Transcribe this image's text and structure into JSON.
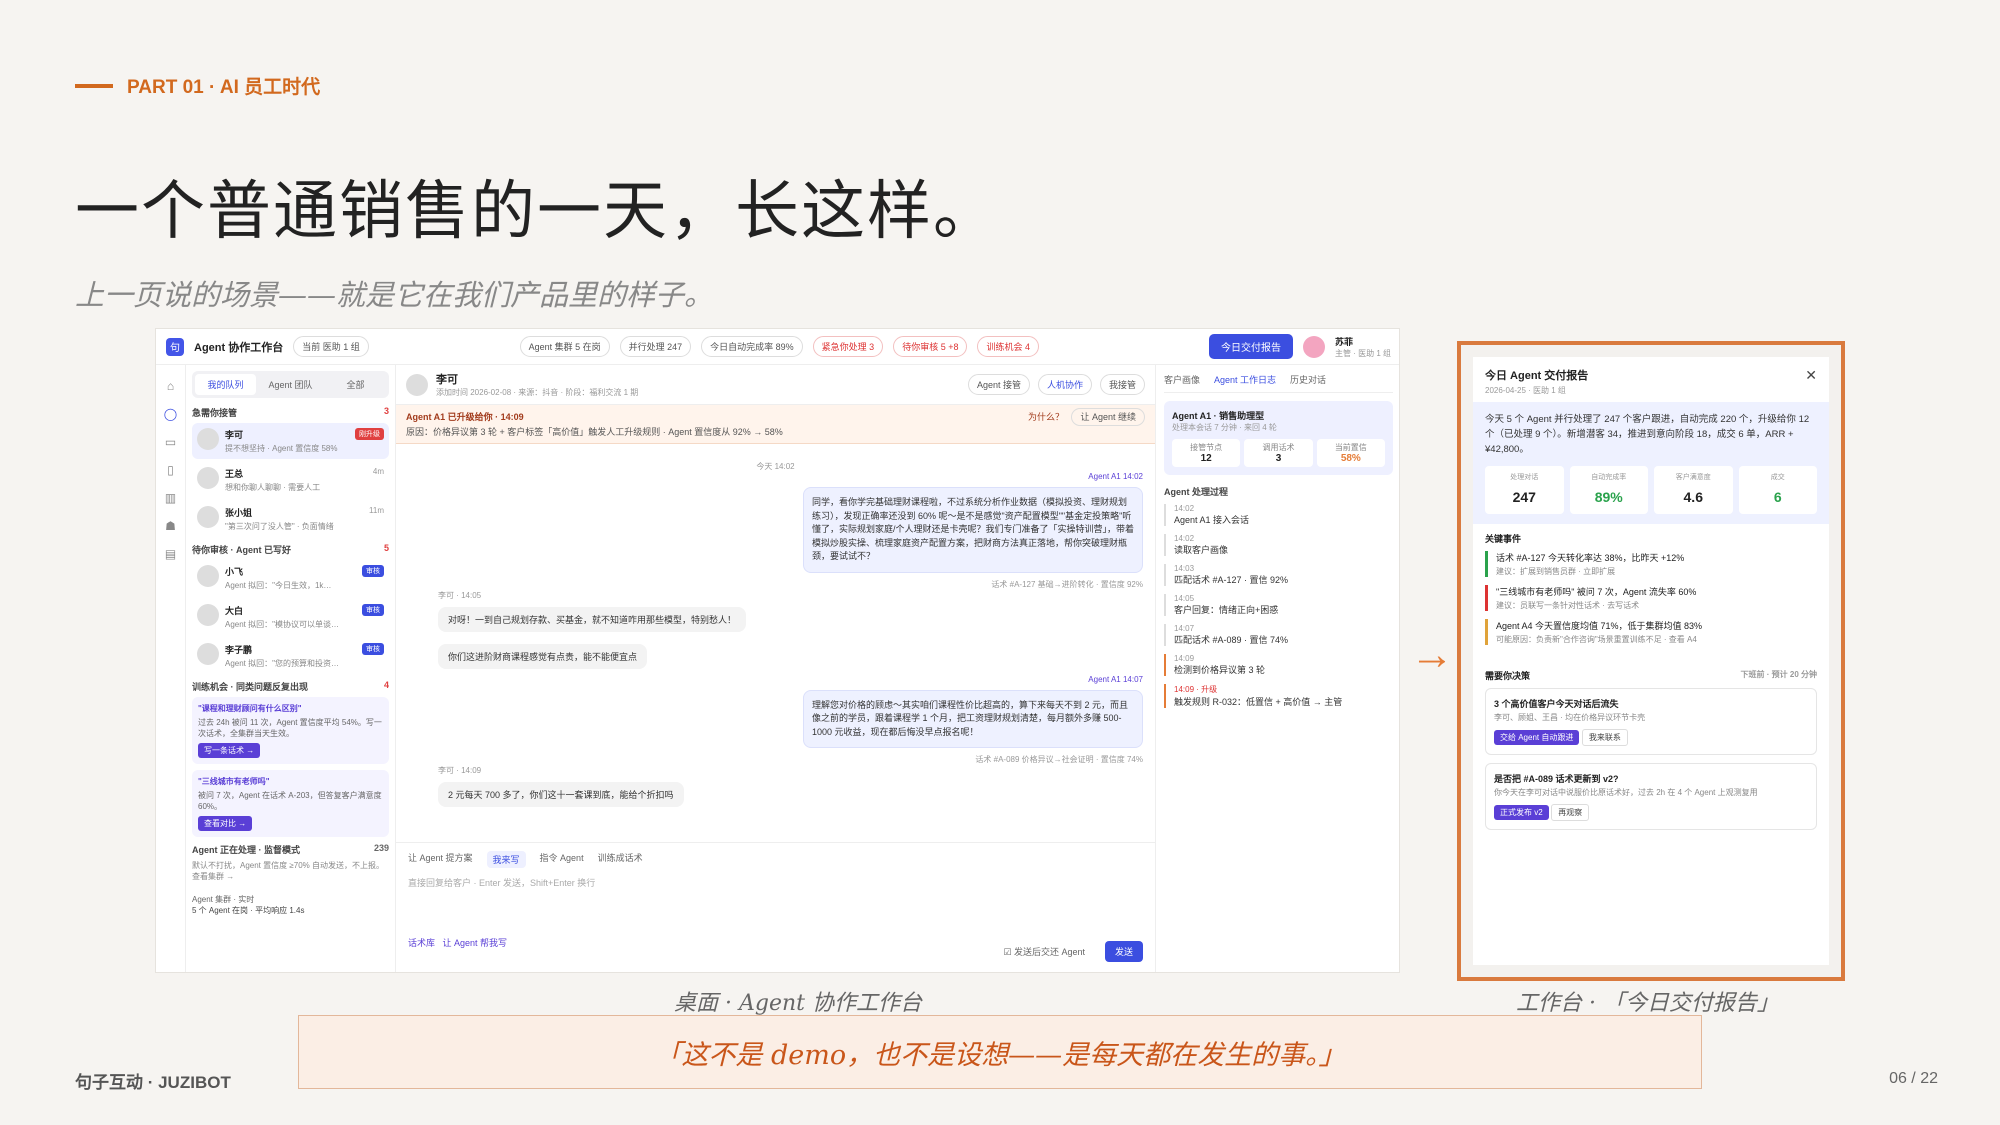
{
  "part": "PART 01 · AI 员工时代",
  "title": "一个普通销售的一天，长这样。",
  "subtitle": "上一页说的场景——就是它在我们产品里的样子。",
  "app": {
    "name": "Agent 协作工作台",
    "current_team": "当前  医助 1 组",
    "status_pills": [
      "Agent 集群  5 在岗",
      "并行处理 247",
      "今日自动完成率 89%"
    ],
    "alerts": [
      "紧急你处理 3",
      "待你审核 5 +8",
      "训练机会 4"
    ],
    "report_btn": "今日交付报告",
    "user_name": "苏菲",
    "user_role": "主管 · 医助 1 组",
    "queue_tabs": [
      "我的队列",
      "Agent 团队",
      "全部"
    ],
    "sec_urgent": "急需你接管",
    "sec_urgent_n": "3",
    "urgent_items": [
      {
        "name": "李可",
        "desc": "提不想坚持 · Agent 置信度 58%",
        "tag": "刚升级"
      },
      {
        "name": "王总",
        "desc": "想和你聊人聊聊 · 需要人工",
        "tag": "4m"
      },
      {
        "name": "张小姐",
        "desc": "\"第三次问了没人管\" · 负面情绪",
        "tag": "11m"
      }
    ],
    "sec_review": "待你审核 · Agent 已写好",
    "sec_review_n": "5",
    "review_items": [
      {
        "name": "小飞",
        "desc": "Agent 拟回：\"今日生效，1k…",
        "tag": "审核"
      },
      {
        "name": "大白",
        "desc": "Agent 拟回：\"模协议可以单谈…",
        "tag": "审核"
      },
      {
        "name": "李子鹏",
        "desc": "Agent 拟回：\"您的预算和投资…",
        "tag": "审核"
      }
    ],
    "sec_train": "训练机会 · 同类问题反复出现",
    "sec_train_n": "4",
    "train_cards": [
      {
        "title": "\"课程和理财顾问有什么区别\"",
        "desc": "过去 24h 被问 11 次，Agent 置信度平均 54%。写一次话术，全集群当天生效。",
        "btn": "写一条话术 →"
      },
      {
        "title": "\"三线城市有老师吗\"",
        "desc": "被问 7 次，Agent 在话术 A-203，但答复客户满意度 60%。",
        "btn": "查看对比 →"
      }
    ],
    "sec_watch": "Agent 正在处理 · 监督模式",
    "sec_watch_n": "239",
    "watch_desc": "默认不打扰，Agent 置信度 ≥70% 自动发送，不上报。查看集群 →",
    "fleet": "Agent 集群 · 实时",
    "fleet_desc": "5 个 Agent 在岗 · 平均响应 1.4s",
    "chat_name": "李可",
    "chat_meta": "添加时间 2026-02-08 · 来源：抖音 · 阶段：福利交流 1 期",
    "chat_actions": [
      "Agent 接管",
      "人机协作",
      "我接管"
    ],
    "alert_title": "Agent A1 已升级给你 · 14:09",
    "alert_desc": "原因：价格异议第 3 轮 + 客户标签「高价值」触发人工升级规则 · Agent 置信度从 92% → 58%",
    "alert_why": "为什么？",
    "alert_takeover": "让 Agent 继续",
    "time_today": "今天 14:02",
    "msg1_from": "Agent A1  14:02",
    "msg1": "同学，看你学完基础理财课程啦，不过系统分析作业数据（模拟投资、理财规划练习），发现正确率还没到 60% 呢～是不是感觉\"资产配置模型\"\"基金定投策略\"听懂了，实际规划家庭/个人理财还是卡壳呢？我们专门准备了「实操特训营」，带着模拟炒股实操、梳理家庭资产配置方案，把财商方法真正落地，帮你突破理财瓶颈，要试试不？",
    "msg1_meta": "话术 #A-127 基础→进阶转化 · 置信度 92%",
    "msg2_from": "李可 · 14:05",
    "msg2": "对呀！一到自己规划存款、买基金，就不知道咋用那些模型，特别愁人！",
    "msg3": "你们这进阶财商课程感觉有点贵，能不能便宜点",
    "msg4_from": "Agent A1  14:07",
    "msg4": "理解您对价格的顾虑～其实咱们课程性价比超高的，算下来每天不到 2 元，而且像之前的学员，跟着课程学 1 个月，把工资理财规划清楚，每月额外多赚 500-1000 元收益，现在都后悔没早点报名呢！",
    "msg4_meta": "话术 #A-089 价格异议→社会证明 · 置信度 74%",
    "msg5_from": "李可 · 14:09",
    "msg5": "2 元每天 700 多了，你们这十一套课到底，能给个折扣吗",
    "composer_tabs": [
      "让 Agent 提方案",
      "我来写",
      "指令 Agent",
      "训练成话术"
    ],
    "composer_hint": "直接回复给客户 · Enter 发送，Shift+Enter 换行",
    "composer_extra": [
      "话术库",
      "让 Agent 帮我写"
    ],
    "composer_check": "发送后交还 Agent",
    "send": "发送",
    "side_tabs": [
      "客户画像",
      "Agent 工作日志",
      "历史对话"
    ],
    "agent_name": "Agent A1 · 销售助理型",
    "agent_sub": "处理本会话 7 分钟 · 来回 4 轮",
    "agent_kpis": [
      {
        "k": "接管节点",
        "v": "12"
      },
      {
        "k": "调用话术",
        "v": "3"
      },
      {
        "k": "当前置信",
        "v": "58%"
      }
    ],
    "timeline_title": "Agent 处理过程",
    "timeline": [
      {
        "t": "14:02",
        "x": "Agent A1 接入会话"
      },
      {
        "t": "14:02",
        "x": "读取客户画像"
      },
      {
        "t": "14:03",
        "x": "匹配话术 #A-127 · 置信 92%"
      },
      {
        "t": "14:05",
        "x": "客户回复：情绪正向+困惑"
      },
      {
        "t": "14:07",
        "x": "匹配话术 #A-089 · 置信 74%"
      },
      {
        "t": "14:09",
        "x": "检测到价格异议第 3 轮"
      },
      {
        "t": "14:09 · 升级",
        "x": "触发规则 R-032：低置信 + 高价值 → 主管"
      }
    ]
  },
  "caption_left": "桌面 · Agent 协作工作台",
  "caption_right": "工作台 · 「今日交付报告」",
  "report": {
    "title": "今日 Agent 交付报告",
    "date": "2026-04-25 · 医助 1 组",
    "summary": "今天 5 个 Agent 并行处理了 247 个客户跟进，自动完成 220 个，升级给你 12 个（已处理 9 个）。新增潜客 34，推进到意向阶段 18，成交 6 单，ARR + ¥42,800。",
    "kpis": [
      {
        "k": "处理对话",
        "v": "247"
      },
      {
        "k": "自动完成率",
        "v": "89%"
      },
      {
        "k": "客户满意度",
        "v": "4.6"
      },
      {
        "k": "成交",
        "v": "6"
      }
    ],
    "events_title": "关键事件",
    "events": [
      {
        "t": "话术 #A-127 今天转化率达 38%，比昨天 +12%",
        "s": "建议：扩展到销售员群 · 立即扩展"
      },
      {
        "t": "\"三线城市有老师吗\" 被问 7 次，Agent 流失率 60%",
        "s": "建议：员联写一条针对性话术 · 去写话术"
      },
      {
        "t": "Agent A4 今天置信度均值 71%，低于集群均值 83%",
        "s": "可能原因：负责新\"合作咨询\"场景重置训练不足 · 查看 A4"
      }
    ],
    "decide_title": "需要你决策",
    "decide_hint": "下班前 · 预计 20 分钟",
    "decisions": [
      {
        "t": "3 个高价值客户今天对话后流失",
        "s": "李可、顾姐、王昌 · 均在价格异议环节卡壳",
        "b1": "交给 Agent 自动跟进",
        "b2": "我来联系"
      },
      {
        "t": "是否把 #A-089 话术更新到 v2?",
        "s": "你今天在李可对话中说服价比原话术好，过去 2h 在 4 个 Agent 上观测复用",
        "b1": "正式发布 v2",
        "b2": "再观察"
      }
    ]
  },
  "quote": "「这不是 demo，也不是设想——是每天都在发生的事。」",
  "footer": "句子互动 · JUZIBOT",
  "page_num": "06 / 22"
}
